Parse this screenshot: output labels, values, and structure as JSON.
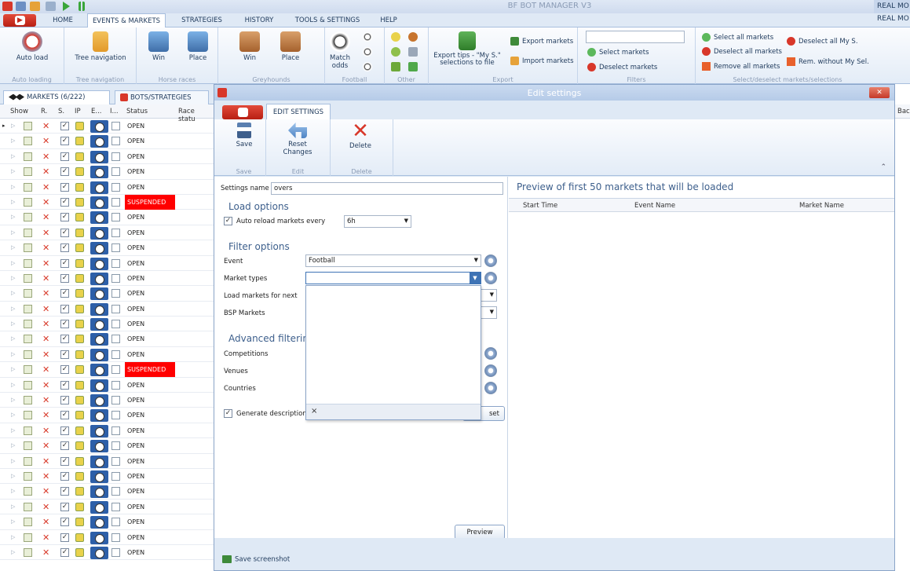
{
  "window": {
    "title": "BF BOT MANAGER V3",
    "mode": "REAL MO"
  },
  "ribbon": {
    "tabs": [
      "HOME",
      "EVENTS & MARKETS",
      "STRATEGIES",
      "HISTORY",
      "TOOLS & SETTINGS",
      "HELP"
    ],
    "active_tab": "EVENTS & MARKETS",
    "mode_label": "REAL MO",
    "groups": {
      "auto_loading": {
        "caption": "Auto loading",
        "button": "Auto load"
      },
      "tree_navigation": {
        "caption": "Tree navigation",
        "button": "Tree navigation"
      },
      "horse_races": {
        "caption": "Horse races",
        "win": "Win",
        "place": "Place"
      },
      "greyhounds": {
        "caption": "Greyhounds",
        "win": "Win",
        "place": "Place"
      },
      "football": {
        "caption": "Football",
        "match_odds": "Match odds"
      },
      "other": {
        "caption": "Other"
      },
      "export": {
        "caption": "Export",
        "export_tips": "Export tips - \"My S.\" selections to file",
        "export_markets": "Export markets",
        "import_markets": "Import markets"
      },
      "filters": {
        "caption": "Filters",
        "select_markets": "Select markets",
        "deselect_markets": "Deselect markets"
      },
      "select_deselect": {
        "caption": "Select/deselect markets/selections",
        "select_all": "Select all markets",
        "deselect_all": "Deselect all markets",
        "remove_all": "Remove all markets",
        "deselect_all_my_s": "Deselect all My S.",
        "rem_without_my_sel": "Rem. without My Sel."
      }
    }
  },
  "left_panel": {
    "tabs": [
      "MARKETS (6/222)",
      "BOTS/STRATEGIES"
    ],
    "columns": [
      "Show",
      "R.",
      "S.",
      "IP",
      "E...",
      "I...",
      "Status",
      "Race statu"
    ],
    "rows": [
      {
        "status": "OPEN",
        "suspended": false
      },
      {
        "status": "OPEN",
        "suspended": false
      },
      {
        "status": "OPEN",
        "suspended": false
      },
      {
        "status": "OPEN",
        "suspended": false
      },
      {
        "status": "OPEN",
        "suspended": false
      },
      {
        "status": "SUSPENDED",
        "suspended": true
      },
      {
        "status": "OPEN",
        "suspended": false
      },
      {
        "status": "OPEN",
        "suspended": false
      },
      {
        "status": "OPEN",
        "suspended": false
      },
      {
        "status": "OPEN",
        "suspended": false
      },
      {
        "status": "OPEN",
        "suspended": false
      },
      {
        "status": "OPEN",
        "suspended": false
      },
      {
        "status": "OPEN",
        "suspended": false
      },
      {
        "status": "OPEN",
        "suspended": false
      },
      {
        "status": "OPEN",
        "suspended": false
      },
      {
        "status": "OPEN",
        "suspended": false
      },
      {
        "status": "SUSPENDED",
        "suspended": true
      },
      {
        "status": "OPEN",
        "suspended": false
      },
      {
        "status": "OPEN",
        "suspended": false
      },
      {
        "status": "OPEN",
        "suspended": false
      },
      {
        "status": "OPEN",
        "suspended": false
      },
      {
        "status": "OPEN",
        "suspended": false
      },
      {
        "status": "OPEN",
        "suspended": false
      },
      {
        "status": "OPEN",
        "suspended": false
      },
      {
        "status": "OPEN",
        "suspended": false
      },
      {
        "status": "OPEN",
        "suspended": false
      },
      {
        "status": "OPEN",
        "suspended": false
      },
      {
        "status": "OPEN",
        "suspended": false
      },
      {
        "status": "OPEN",
        "suspended": false
      }
    ]
  },
  "dialog": {
    "title": "Edit settings",
    "tab": "EDIT SETTINGS",
    "ribbon": {
      "save": "Save",
      "save_caption": "Save",
      "reset": "Reset Changes",
      "edit_caption": "Edit",
      "delete": "Delete",
      "delete_caption": "Delete"
    },
    "form": {
      "settings_name_label": "Settings name",
      "settings_name_value": "overs",
      "load_options_heading": "Load options",
      "auto_reload_label": "Auto reload markets every",
      "auto_reload_checked": true,
      "auto_reload_value": "6h",
      "filter_options_heading": "Filter options",
      "event_label": "Event",
      "event_value": "Football",
      "market_types_label": "Market types",
      "market_types_value": "",
      "load_markets_for_next_label": "Load markets for next",
      "bsp_markets_label": "BSP Markets",
      "advanced_filtering_heading": "Advanced filtering",
      "competitions_label": "Competitions",
      "venues_label": "Venues",
      "countries_label": "Countries",
      "generate_description_label": "Generate description fo",
      "generate_description_checked": true,
      "reset_button_partial": "set",
      "dropdown_clear": "×",
      "preview_button": "Preview"
    },
    "preview": {
      "title": "Preview of first 50 markets that will be loaded",
      "columns": [
        "Start Time",
        "Event Name",
        "Market Name"
      ]
    },
    "status": {
      "save_screenshot": "Save screenshot"
    }
  },
  "right_strip": {
    "column": "Bac"
  },
  "colors": {
    "accent": "#3e73b5",
    "brand_red": "#d8372a",
    "suspended": "#ff0000",
    "section_heading": "#3d5f8c"
  }
}
